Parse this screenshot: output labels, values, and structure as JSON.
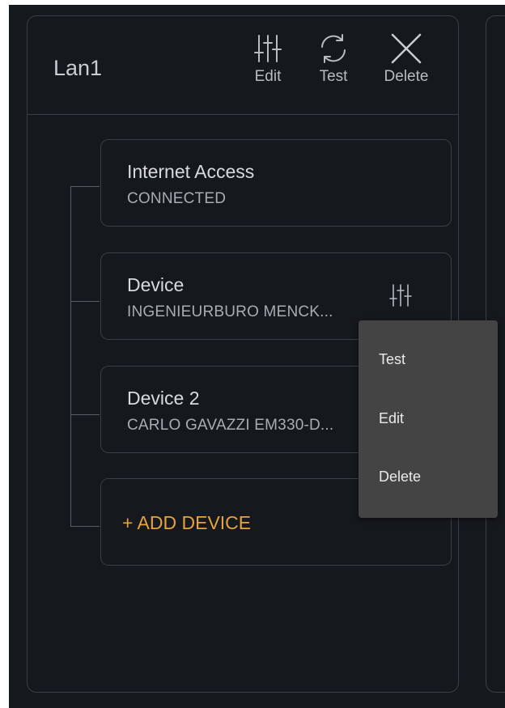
{
  "panel": {
    "title": "Lan1",
    "actions": [
      {
        "label": "Edit",
        "icon": "sliders-icon"
      },
      {
        "label": "Test",
        "icon": "refresh-icon"
      },
      {
        "label": "Delete",
        "icon": "close-icon"
      }
    ]
  },
  "cards": [
    {
      "name": "Internet Access",
      "subtitle": "CONNECTED"
    },
    {
      "name": "Device",
      "subtitle": "INGENIEURBURO MENCK..."
    },
    {
      "name": "Device 2",
      "subtitle": "CARLO GAVAZZI EM330-D..."
    }
  ],
  "add_device": {
    "label": "+ ADD DEVICE"
  },
  "context_menu": {
    "items": [
      "Test",
      "Edit",
      "Delete"
    ]
  },
  "colors": {
    "background": "#15181c",
    "border": "#3a3f45",
    "accent": "#e6a23c",
    "menu": "#444444"
  }
}
